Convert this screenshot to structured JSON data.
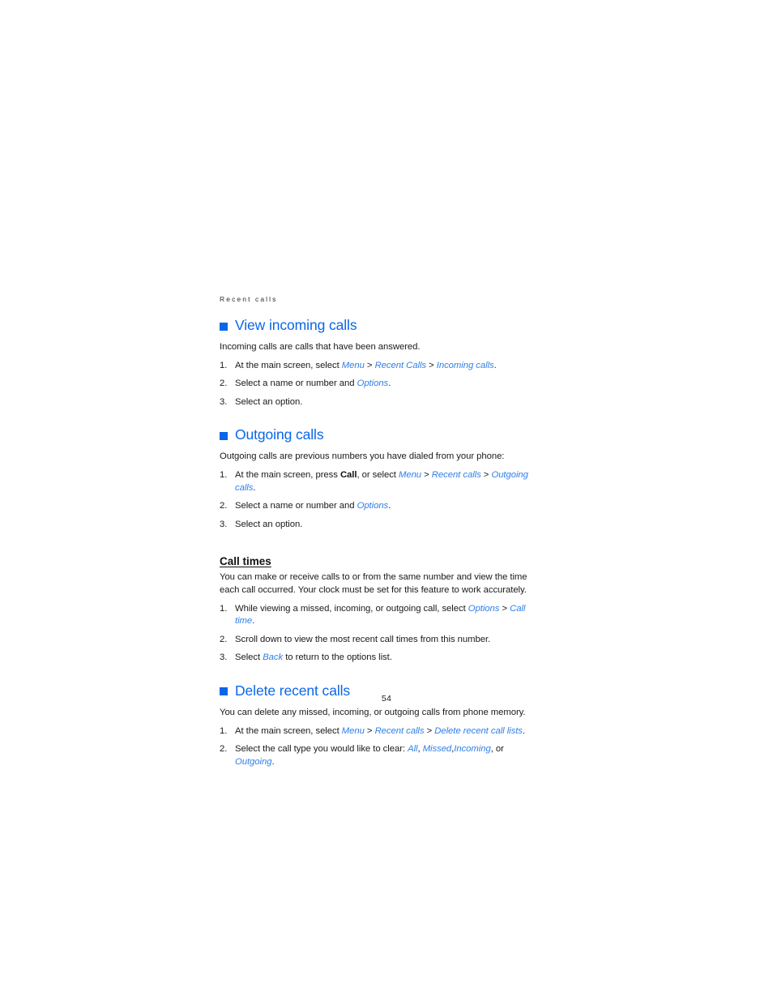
{
  "document": {
    "running_head": "Recent calls",
    "page_number": "54",
    "accent_color": "#0a66e8",
    "link_color": "#2f7fe8",
    "text_color": "#1a1a1a"
  },
  "sections": [
    {
      "heading": "View incoming calls",
      "intro": "Incoming calls are calls that have been answered.",
      "steps": [
        {
          "number": "1.",
          "parts": [
            {
              "type": "text",
              "text": "At the main screen, select "
            },
            {
              "type": "ui",
              "text": "Menu"
            },
            {
              "type": "sep",
              "text": " > "
            },
            {
              "type": "ui",
              "text": "Recent Calls"
            },
            {
              "type": "sep",
              "text": " > "
            },
            {
              "type": "ui",
              "text": "Incoming calls"
            },
            {
              "type": "text",
              "text": "."
            }
          ]
        },
        {
          "number": "2.",
          "parts": [
            {
              "type": "text",
              "text": "Select a name or number and "
            },
            {
              "type": "ui",
              "text": "Options"
            },
            {
              "type": "text",
              "text": "."
            }
          ]
        },
        {
          "number": "3.",
          "parts": [
            {
              "type": "text",
              "text": "Select an option."
            }
          ]
        }
      ]
    },
    {
      "heading": "Outgoing calls",
      "intro": "Outgoing calls are previous numbers you have dialed from your phone:",
      "steps": [
        {
          "number": "1.",
          "parts": [
            {
              "type": "text",
              "text": "At the main screen, press "
            },
            {
              "type": "key",
              "text": "Call"
            },
            {
              "type": "text",
              "text": ", or select "
            },
            {
              "type": "ui",
              "text": "Menu"
            },
            {
              "type": "sep",
              "text": " > "
            },
            {
              "type": "ui",
              "text": "Recent calls"
            },
            {
              "type": "sep",
              "text": " > "
            },
            {
              "type": "ui",
              "text": "Outgoing calls"
            },
            {
              "type": "text",
              "text": "."
            }
          ]
        },
        {
          "number": "2.",
          "parts": [
            {
              "type": "text",
              "text": "Select a name or number and "
            },
            {
              "type": "ui",
              "text": "Options"
            },
            {
              "type": "text",
              "text": "."
            }
          ]
        },
        {
          "number": "3.",
          "parts": [
            {
              "type": "text",
              "text": "Select an option."
            }
          ]
        }
      ],
      "subsection": {
        "heading": "Call times",
        "intro": "You can make or receive calls to or from the same number and view the time each call occurred. Your clock must be set for this feature to work accurately.",
        "steps": [
          {
            "number": "1.",
            "parts": [
              {
                "type": "text",
                "text": "While viewing a missed, incoming, or outgoing call, select "
              },
              {
                "type": "ui",
                "text": "Options"
              },
              {
                "type": "sep",
                "text": " > "
              },
              {
                "type": "ui",
                "text": "Call time"
              },
              {
                "type": "text",
                "text": "."
              }
            ]
          },
          {
            "number": "2.",
            "parts": [
              {
                "type": "text",
                "text": "Scroll down to view the most recent call times from this number."
              }
            ]
          },
          {
            "number": "3.",
            "parts": [
              {
                "type": "text",
                "text": "Select "
              },
              {
                "type": "ui",
                "text": "Back"
              },
              {
                "type": "text",
                "text": " to return to the options list."
              }
            ]
          }
        ]
      }
    },
    {
      "heading": "Delete recent calls",
      "intro": "You can delete any missed, incoming, or outgoing calls from phone memory.",
      "steps": [
        {
          "number": "1.",
          "parts": [
            {
              "type": "text",
              "text": "At the main screen, select "
            },
            {
              "type": "ui",
              "text": "Menu"
            },
            {
              "type": "sep",
              "text": " > "
            },
            {
              "type": "ui",
              "text": "Recent calls"
            },
            {
              "type": "sep",
              "text": " > "
            },
            {
              "type": "ui",
              "text": "Delete recent call lists"
            },
            {
              "type": "text",
              "text": "."
            }
          ]
        },
        {
          "number": "2.",
          "parts": [
            {
              "type": "text",
              "text": "Select the call type you would like to clear: "
            },
            {
              "type": "ui",
              "text": "All"
            },
            {
              "type": "text",
              "text": ", "
            },
            {
              "type": "ui",
              "text": "Missed"
            },
            {
              "type": "text",
              "text": ","
            },
            {
              "type": "ui",
              "text": "Incoming"
            },
            {
              "type": "text",
              "text": ", or "
            },
            {
              "type": "ui",
              "text": "Outgoing"
            },
            {
              "type": "text",
              "text": "."
            }
          ]
        }
      ]
    }
  ]
}
